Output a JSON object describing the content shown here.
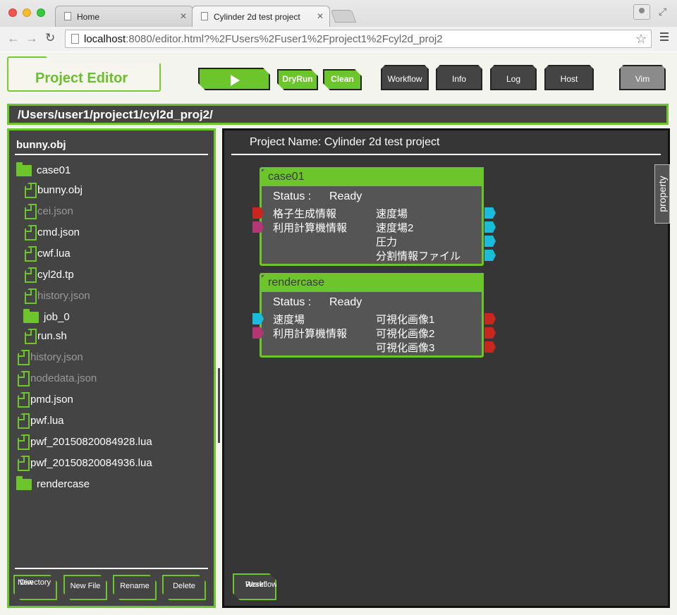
{
  "browser": {
    "tabs": [
      {
        "label": "Home"
      },
      {
        "label": "Cylinder 2d test project"
      }
    ],
    "url_host": "localhost",
    "url_rest": ":8080/editor.html?%2FUsers%2Fuser1%2Fproject1%2Fcyl2d_proj2"
  },
  "header": {
    "title": "Project Editor",
    "buttons": {
      "dryrun": "DryRun",
      "clean": "Clean",
      "workflow": "Workflow",
      "info": "Info",
      "log": "Log",
      "host": "Host",
      "vim": "Vim"
    }
  },
  "path": "/Users/user1/project1/cyl2d_proj2/",
  "file_panel": {
    "title": "bunny.obj",
    "items": [
      {
        "label": "case01",
        "type": "folder",
        "depth": 0,
        "dim": false
      },
      {
        "label": "bunny.obj",
        "type": "file",
        "depth": 1,
        "dim": false
      },
      {
        "label": "cei.json",
        "type": "file",
        "depth": 1,
        "dim": true
      },
      {
        "label": "cmd.json",
        "type": "file",
        "depth": 1,
        "dim": false
      },
      {
        "label": "cwf.lua",
        "type": "file",
        "depth": 1,
        "dim": false
      },
      {
        "label": "cyl2d.tp",
        "type": "file",
        "depth": 1,
        "dim": false
      },
      {
        "label": "history.json",
        "type": "file",
        "depth": 1,
        "dim": true
      },
      {
        "label": "job_0",
        "type": "folder",
        "depth": 1,
        "dim": false
      },
      {
        "label": "run.sh",
        "type": "file",
        "depth": 1,
        "dim": false
      },
      {
        "label": "history.json",
        "type": "file",
        "depth": 0,
        "dim": true
      },
      {
        "label": "nodedata.json",
        "type": "file",
        "depth": 0,
        "dim": true
      },
      {
        "label": "pmd.json",
        "type": "file",
        "depth": 0,
        "dim": false
      },
      {
        "label": "pwf.lua",
        "type": "file",
        "depth": 0,
        "dim": false
      },
      {
        "label": "pwf_20150820084928.lua",
        "type": "file",
        "depth": 0,
        "dim": false
      },
      {
        "label": "pwf_20150820084936.lua",
        "type": "file",
        "depth": 0,
        "dim": false
      },
      {
        "label": "rendercase",
        "type": "folder",
        "depth": 0,
        "dim": false
      }
    ],
    "buttons": {
      "new_directory_1": "New",
      "new_directory_2": "Directory",
      "new_file": "New File",
      "rename": "Rename",
      "delete": "Delete"
    }
  },
  "workflow": {
    "project_name": "Project Name: Cylinder 2d test project",
    "property_tab": "property",
    "reset_1": "Reset",
    "reset_2": "Workflow",
    "nodes": [
      {
        "title": "case01",
        "status_key": "Status :",
        "status_value": "Ready",
        "inputs": [
          {
            "label": "格子生成情報",
            "color": "#c8261e"
          },
          {
            "label": "利用計算機情報",
            "color": "#b23774"
          }
        ],
        "outputs": [
          {
            "label": "速度場",
            "color": "#19bcd9"
          },
          {
            "label": "速度場2",
            "color": "#19bcd9"
          },
          {
            "label": "圧力",
            "color": "#19bcd9"
          },
          {
            "label": "分割情報ファイル",
            "color": "#19bcd9"
          }
        ]
      },
      {
        "title": "rendercase",
        "status_key": "Status :",
        "status_value": "Ready",
        "inputs": [
          {
            "label": "速度場",
            "color": "#19bcd9"
          },
          {
            "label": "利用計算機情報",
            "color": "#b23774"
          }
        ],
        "outputs": [
          {
            "label": "可視化画像1",
            "color": "#c8261e"
          },
          {
            "label": "可視化画像2",
            "color": "#c8261e"
          },
          {
            "label": "可視化画像3",
            "color": "#c8261e"
          }
        ]
      }
    ]
  },
  "colors": {
    "accent": "#6cc52b",
    "panel_bg": "#444444",
    "workflow_bg": "#363636"
  }
}
